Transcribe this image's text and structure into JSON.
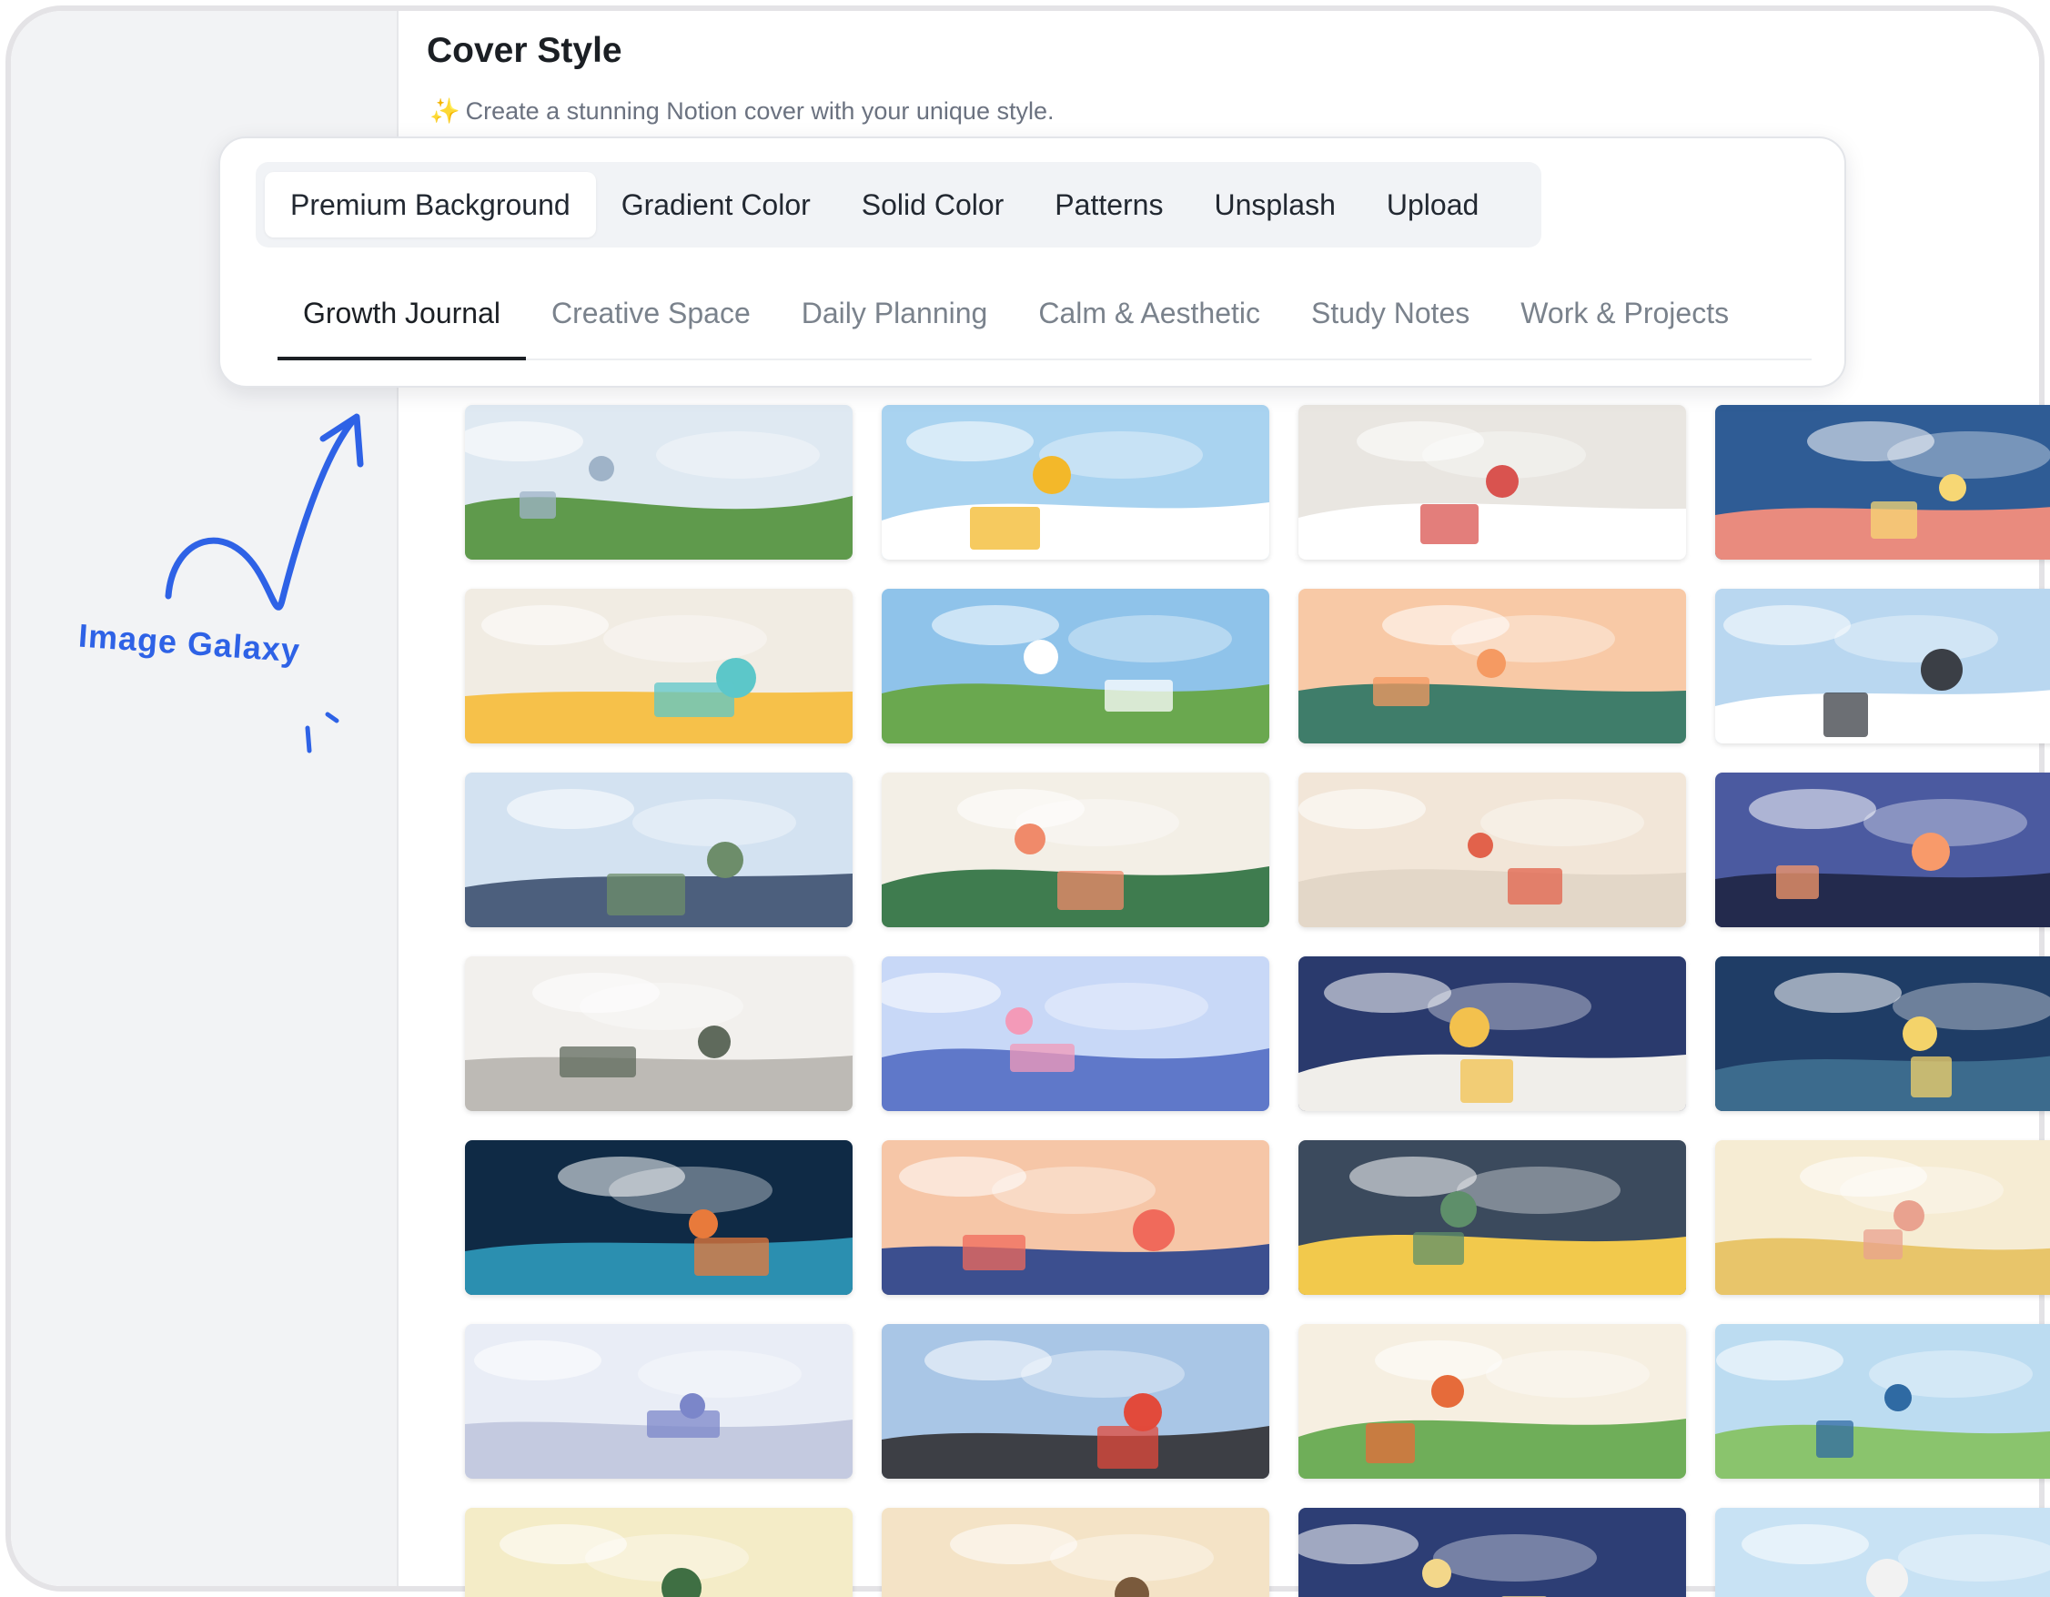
{
  "header": {
    "title": "Cover Style",
    "subtitle": "Create a stunning Notion cover with your unique style.",
    "subtitle_icon": "sparkles-icon"
  },
  "source_tabs": [
    {
      "label": "Premium Background",
      "active": true
    },
    {
      "label": "Gradient Color",
      "active": false
    },
    {
      "label": "Solid Color",
      "active": false
    },
    {
      "label": "Patterns",
      "active": false
    },
    {
      "label": "Unsplash",
      "active": false
    },
    {
      "label": "Upload",
      "active": false
    }
  ],
  "category_tabs": [
    {
      "label": "Growth Journal",
      "active": true
    },
    {
      "label": "Creative Space",
      "active": false
    },
    {
      "label": "Daily Planning",
      "active": false
    },
    {
      "label": "Calm & Aesthetic",
      "active": false
    },
    {
      "label": "Study Notes",
      "active": false
    },
    {
      "label": "Work & Projects",
      "active": false
    }
  ],
  "annotation": {
    "label": "Image Galaxy",
    "color": "#2e62e6"
  },
  "gallery": {
    "rows": 8,
    "columns": 4,
    "thumbnails": [
      {
        "scene": "city-skyline-bench",
        "sky": "#dfe9f2",
        "ground": "#5f9a4c",
        "accent": "#9fb3c8"
      },
      {
        "scene": "gold-coins-clouds",
        "sky": "#a9d3f0",
        "ground": "#ffffff",
        "accent": "#f3b82a"
      },
      {
        "scene": "desk-craft-flatlay",
        "sky": "#e9e6e1",
        "ground": "#ffffff",
        "accent": "#d9534f"
      },
      {
        "scene": "open-book-lamp",
        "sky": "#2f5c95",
        "ground": "#e98b7e",
        "accent": "#f7d774"
      },
      {
        "scene": "sticky-notes-wall",
        "sky": "#f1ece3",
        "ground": "#f6c14a",
        "accent": "#5cc7c9"
      },
      {
        "scene": "hiker-green-hill",
        "sky": "#8fc3ea",
        "ground": "#6aa84f",
        "accent": "#ffffff"
      },
      {
        "scene": "sunrise-mountains",
        "sky": "#f8c9a6",
        "ground": "#3f7d6a",
        "accent": "#f59a62"
      },
      {
        "scene": "snow-cabin-skiers",
        "sky": "#b9d7f0",
        "ground": "#ffffff",
        "accent": "#3b3f46"
      },
      {
        "scene": "canyon-cliff",
        "sky": "#d3e2f1",
        "ground": "#4c5f7d",
        "accent": "#6d8d6a"
      },
      {
        "scene": "greenhouse-flowers",
        "sky": "#f3efe6",
        "ground": "#3f7c4f",
        "accent": "#f08a6a"
      },
      {
        "scene": "european-street",
        "sky": "#f2e6d8",
        "ground": "#e3d7c8",
        "accent": "#e2624b"
      },
      {
        "scene": "sunset-hill",
        "sky": "#4b5aa0",
        "ground": "#232a4d",
        "accent": "#f89a6a"
      },
      {
        "scene": "window-desk-winter",
        "sky": "#f2f0ed",
        "ground": "#bdbab5",
        "accent": "#5f6a5c"
      },
      {
        "scene": "neon-bridge-city",
        "sky": "#c8d8f7",
        "ground": "#5f78c9",
        "accent": "#f39ab8"
      },
      {
        "scene": "balcony-reader-night",
        "sky": "#2a3a6d",
        "ground": "#f0eeea",
        "accent": "#f3c14d"
      },
      {
        "scene": "typewriter-study",
        "sky": "#1f3d66",
        "ground": "#3c6b8d",
        "accent": "#f4d36a"
      },
      {
        "scene": "glowing-tunnel",
        "sky": "#0f2a45",
        "ground": "#2b8fb0",
        "accent": "#e87a3b"
      },
      {
        "scene": "year-ahead-planner",
        "sky": "#f6c6a7",
        "ground": "#3c4f8f",
        "accent": "#f06a5b"
      },
      {
        "scene": "cafe-barista",
        "sky": "#3b4a5d",
        "ground": "#f2c94c",
        "accent": "#5e8f6a"
      },
      {
        "scene": "ribbon-dancer",
        "sky": "#f6ecd3",
        "ground": "#e8c56a",
        "accent": "#e9a28f"
      },
      {
        "scene": "home-yoga",
        "sky": "#e9edf6",
        "ground": "#c4cae0",
        "accent": "#7b86c9"
      },
      {
        "scene": "city-crowd-billboards",
        "sky": "#a9c6e6",
        "ground": "#3d3f45",
        "accent": "#e24a3b"
      },
      {
        "scene": "runners-with-dogs",
        "sky": "#f6efe1",
        "ground": "#6fae59",
        "accent": "#e66b3a"
      },
      {
        "scene": "hikers-coastline",
        "sky": "#bcdcf1",
        "ground": "#8ac46d",
        "accent": "#2f6aa3"
      },
      {
        "scene": "garden-plants",
        "sky": "#f4ecc7",
        "ground": "#7cae5c",
        "accent": "#3f6f43"
      },
      {
        "scene": "autumn-park",
        "sky": "#f4e3c6",
        "ground": "#e8a23b",
        "accent": "#7a5a3c"
      },
      {
        "scene": "library-night-lamp",
        "sky": "#2d3e75",
        "ground": "#5a6db0",
        "accent": "#f3d78a"
      },
      {
        "scene": "birds-sky-dancer",
        "sky": "#c8e2f4",
        "ground": "#e9f3fb",
        "accent": "#f2f2f2"
      }
    ]
  }
}
